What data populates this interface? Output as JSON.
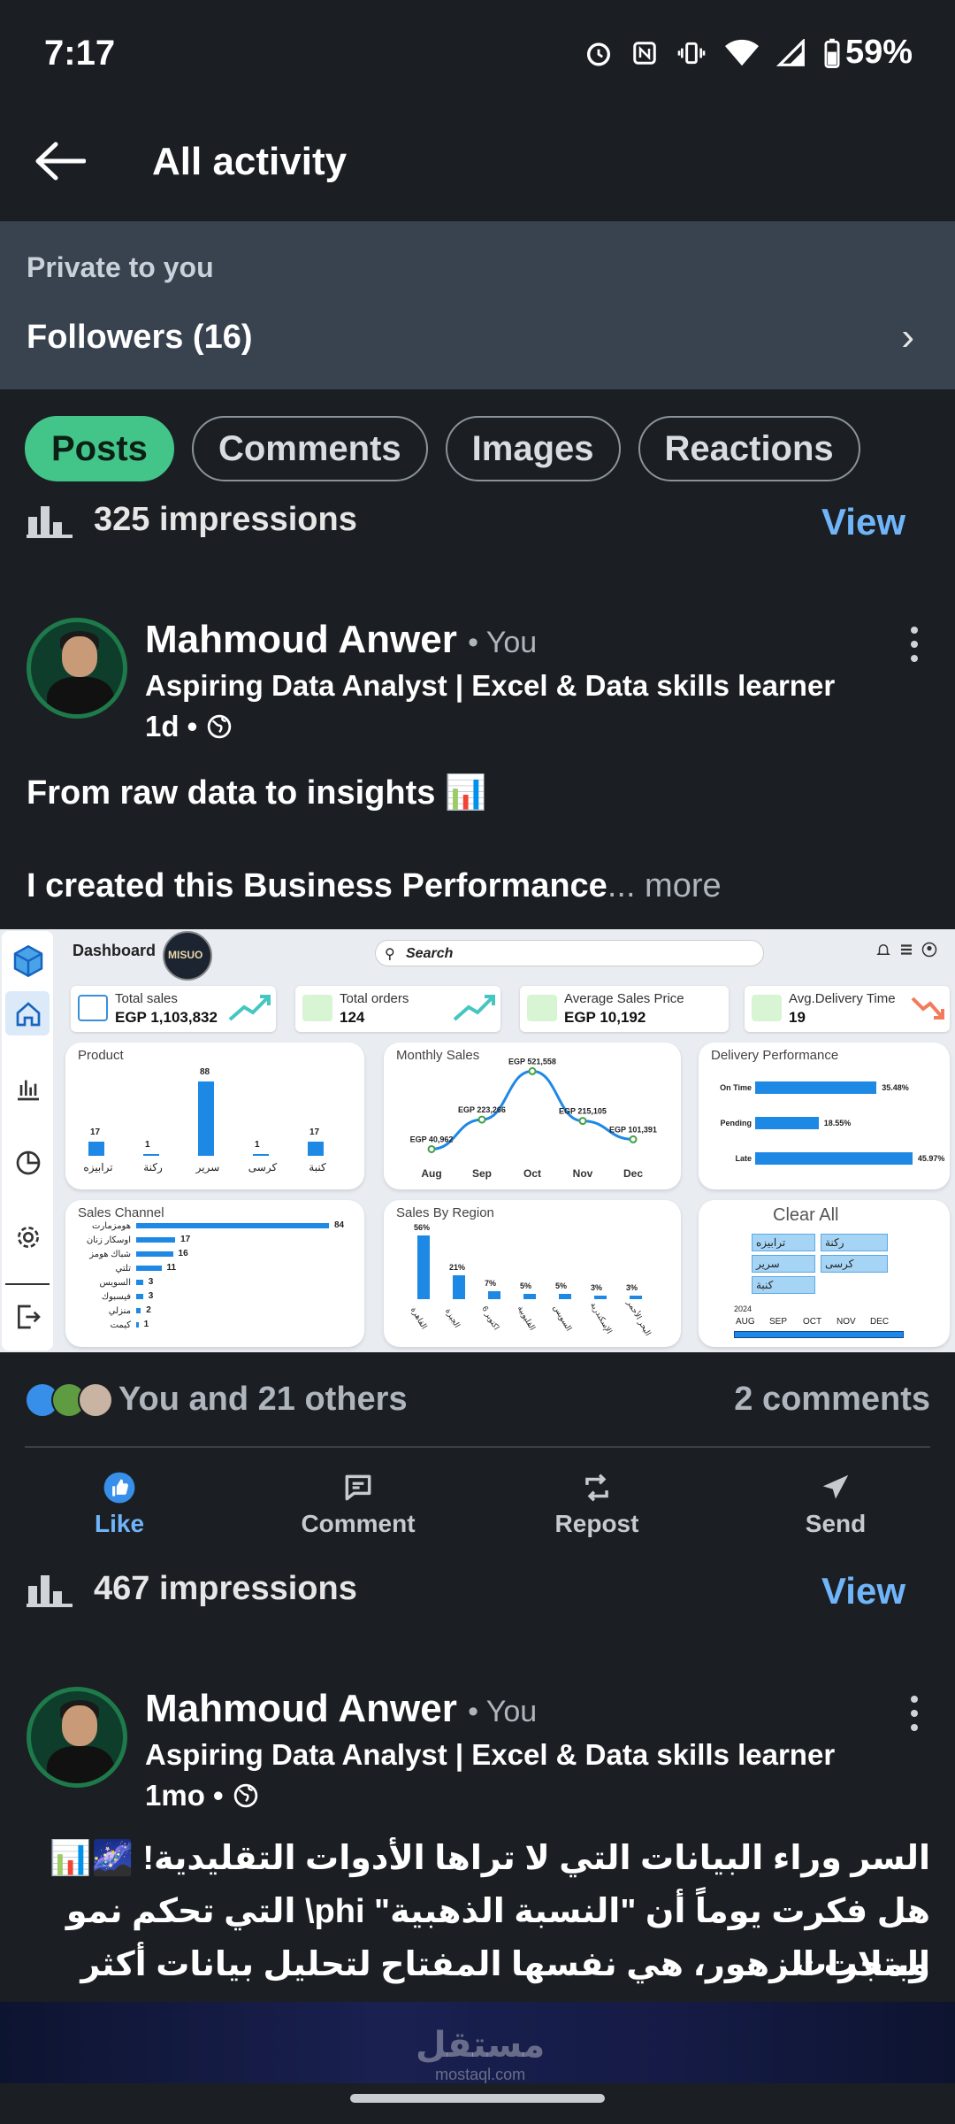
{
  "status_bar": {
    "time": "7:17",
    "battery": "59%"
  },
  "app_bar": {
    "title": "All activity"
  },
  "private": {
    "caption": "Private to you",
    "followers": "Followers (16)",
    "chevron": "›"
  },
  "tabs": [
    {
      "label": "Posts",
      "active": true
    },
    {
      "label": "Comments",
      "active": false
    },
    {
      "label": "Images",
      "active": false
    },
    {
      "label": "Reactions",
      "active": false
    }
  ],
  "posts": [
    {
      "impressions": "325 impressions",
      "view_label": "View",
      "author": "Mahmoud Anwer",
      "you_tag": "• You",
      "headline": "Aspiring Data Analyst | Excel & Data skills learner",
      "time": "1d •",
      "text_line1": "From raw data to insights 📊",
      "text_line2": "I created this Business Performance",
      "more": "... more",
      "reactions_text": "You and 21 others",
      "comments": "2 comments"
    },
    {
      "impressions": "467 impressions",
      "view_label": "View",
      "author": "Mahmoud Anwer",
      "you_tag": "• You",
      "headline": "Aspiring Data Analyst | Excel & Data skills learner",
      "time": "1mo •",
      "ar_line1": "السر وراء البيانات التي لا تراها الأدوات التقليدية! 🌌📊",
      "ar_line2": "هل فكرت يوماً أن \"النسبة الذهبية\" phi\\ التي تحكم نمو المجرات",
      "ar_line3": "وبتلات الزهور، هي نفسها المفتاح لتحليل بيانات أكثر ذكاءً؟ ... more"
    }
  ],
  "actions": {
    "like": "Like",
    "comment": "Comment",
    "repost": "Repost",
    "send": "Send"
  },
  "dashboard": {
    "title": "Dashboard",
    "logo": "MISUO",
    "search": "Search",
    "kpis": [
      {
        "label": "Total sales",
        "value": "EGP 1,103,832"
      },
      {
        "label": "Total orders",
        "value": "124"
      },
      {
        "label": "Average Sales Price",
        "value": "EGP 10,192"
      },
      {
        "label": "Avg.Delivery Time",
        "value": "19"
      }
    ],
    "product": {
      "title": "Product",
      "categories": [
        "ترابيزه",
        "ركنة",
        "سرير",
        "كرسى",
        "كنبة"
      ],
      "values": [
        17,
        1,
        88,
        1,
        17
      ]
    },
    "monthly": {
      "title": "Monthly Sales",
      "x": [
        "Aug",
        "Sep",
        "Oct",
        "Nov",
        "Dec"
      ],
      "labels": [
        "EGP 40,962",
        "EGP 223,266",
        "EGP 521,558",
        "EGP 215,105",
        "EGP 101,391"
      ],
      "values": [
        40962,
        223266,
        521558,
        215105,
        101391
      ]
    },
    "delivery": {
      "title": "Delivery Performance",
      "categories": [
        "On Time",
        "Pending",
        "Late"
      ],
      "values": [
        "35.48%",
        "18.55%",
        "45.97%"
      ],
      "numbers": [
        35.48,
        18.55,
        45.97
      ]
    },
    "channel": {
      "title": "Sales Channel",
      "categories": [
        "هومزمارت",
        "اوسكار زنان",
        "شباك هومز",
        "تلتي",
        "السويس",
        "فيسبوك",
        "منزلي",
        "كيمت"
      ],
      "values": [
        84,
        17,
        16,
        11,
        3,
        3,
        2,
        1
      ]
    },
    "region": {
      "title": "Sales By Region",
      "categories": [
        "القاهرة",
        "الجيزة",
        "6 اكتوبر",
        "القليوبية",
        "السويس",
        "الإسكندرية",
        "البحر الأحمر"
      ],
      "labels": [
        "56%",
        "21%",
        "7%",
        "5%",
        "5%",
        "3%",
        "3%"
      ],
      "values": [
        56,
        21,
        7,
        5,
        5,
        3,
        3
      ]
    },
    "slicer": {
      "clear": "Clear All",
      "items": [
        "ترابيزه",
        "ركنة",
        "سرير",
        "كرسى",
        "كنبة"
      ],
      "year": "2024",
      "months": [
        "AUG",
        "SEP",
        "OCT",
        "NOV",
        "DEC"
      ]
    }
  },
  "watermark": {
    "text": "مستقل",
    "sub": "mostaql.com"
  },
  "colors": {
    "accent": "#70b5f9",
    "active_tab": "#43c58a",
    "bar": "#1e88e5"
  }
}
